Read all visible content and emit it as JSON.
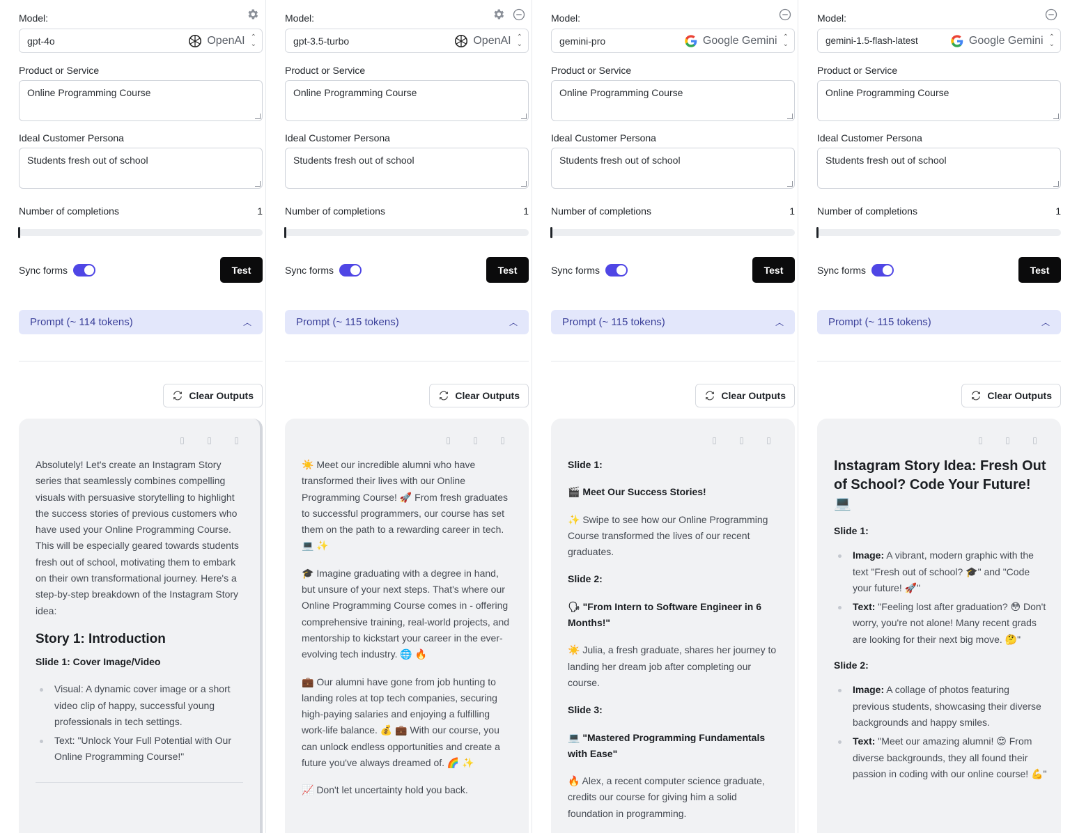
{
  "columns": [
    {
      "model_label": "Model:",
      "model_value": "gpt-4o",
      "provider": "OpenAI",
      "product_label": "Product or Service",
      "product_value": "Online Programming Course",
      "persona_label": "Ideal Customer Persona",
      "persona_value": "Students fresh out of school",
      "num_label": "Number of completions",
      "num_value": "1",
      "sync_label": "Sync forms",
      "test_label": "Test",
      "prompt_label": "Prompt (~ 114 tokens)",
      "clear_label": "Clear Outputs",
      "output": {
        "p1": "Absolutely! Let's create an Instagram Story series that seamlessly combines compelling visuals with persuasive storytelling to highlight the success stories of previous customers who have used your Online Programming Course. This will be especially geared towards students fresh out of school, motivating them to embark on their own transformational journey. Here's a step-by-step breakdown of the Instagram Story idea:",
        "h2": "Story 1: Introduction",
        "sub": "Slide 1: Cover Image/Video",
        "li1": "Visual: A dynamic cover image or a short video clip of happy, successful young professionals in tech settings.",
        "li2": "Text: \"Unlock Your Full Potential with Our Online Programming Course!\""
      }
    },
    {
      "model_label": "Model:",
      "model_value": "gpt-3.5-turbo",
      "provider": "OpenAI",
      "product_label": "Product or Service",
      "product_value": "Online Programming Course",
      "persona_label": "Ideal Customer Persona",
      "persona_value": "Students fresh out of school",
      "num_label": "Number of completions",
      "num_value": "1",
      "sync_label": "Sync forms",
      "test_label": "Test",
      "prompt_label": "Prompt (~ 115 tokens)",
      "clear_label": "Clear Outputs",
      "output": {
        "p1": "Meet our incredible alumni who have transformed their lives with our Online Programming Course! 🚀 From fresh graduates to successful programmers, our course has set them on the path to a rewarding career in tech. 💻 ✨",
        "p2": "🎓 Imagine graduating with a degree in hand, but unsure of your next steps. That's where our Online Programming Course comes in - offering comprehensive training, real-world projects, and mentorship to kickstart your career in the ever-evolving tech industry. 🌐 🔥",
        "p3": "💼 Our alumni have gone from job hunting to landing roles at top tech companies, securing high-paying salaries and enjoying a fulfilling work-life balance. 💰 💼 With our course, you can unlock endless opportunities and create a future you've always dreamed of. 🌈 ✨",
        "p4": "📈 Don't let uncertainty hold you back."
      }
    },
    {
      "model_label": "Model:",
      "model_value": "gemini-pro",
      "provider": "Google Gemini",
      "product_label": "Product or Service",
      "product_value": "Online Programming Course",
      "persona_label": "Ideal Customer Persona",
      "persona_value": "Students fresh out of school",
      "num_label": "Number of completions",
      "num_value": "1",
      "sync_label": "Sync forms",
      "test_label": "Test",
      "prompt_label": "Prompt (~ 115 tokens)",
      "clear_label": "Clear Outputs",
      "output": {
        "s1": "Slide 1:",
        "s1b": "🎬 Meet Our Success Stories!",
        "s1t": "✨ Swipe to see how our Online Programming Course transformed the lives of our recent graduates.",
        "s2": "Slide 2:",
        "s2b": "🗣 \"From Intern to Software Engineer in 6 Months!\"",
        "s2t": "☀️ Julia, a fresh graduate, shares her journey to landing her dream job after completing our course.",
        "s3": "Slide 3:",
        "s3b": "💻 \"Mastered Programming Fundamentals with Ease\"",
        "s3t": "🔥 Alex, a recent computer science graduate, credits our course for giving him a solid foundation in programming."
      }
    },
    {
      "model_label": "Model:",
      "model_value": "gemini-1.5-flash-latest",
      "provider": "Google Gemini",
      "product_label": "Product or Service",
      "product_value": "Online Programming Course",
      "persona_label": "Ideal Customer Persona",
      "persona_value": "Students fresh out of school",
      "num_label": "Number of completions",
      "num_value": "1",
      "sync_label": "Sync forms",
      "test_label": "Test",
      "prompt_label": "Prompt (~ 115 tokens)",
      "clear_label": "Clear Outputs",
      "output": {
        "h1": "Instagram Story Idea: Fresh Out of School? Code Your Future! 💻",
        "s1": "Slide 1:",
        "l1a_b": "Image:",
        "l1a": " A vibrant, modern graphic with the text \"Fresh out of school? 🎓\" and \"Code your future! 🚀\"",
        "l1b_b": "Text:",
        "l1b": " \"Feeling lost after graduation? 😳 Don't worry, you're not alone! Many recent grads are looking for their next big move. 🤔\"",
        "s2": "Slide 2:",
        "l2a_b": "Image:",
        "l2a": " A collage of photos featuring previous students, showcasing their diverse backgrounds and happy smiles.",
        "l2b_b": "Text:",
        "l2b": " \"Meet our amazing alumni! 😍 From diverse backgrounds, they all found their passion in coding with our online course! 💪\""
      }
    }
  ]
}
